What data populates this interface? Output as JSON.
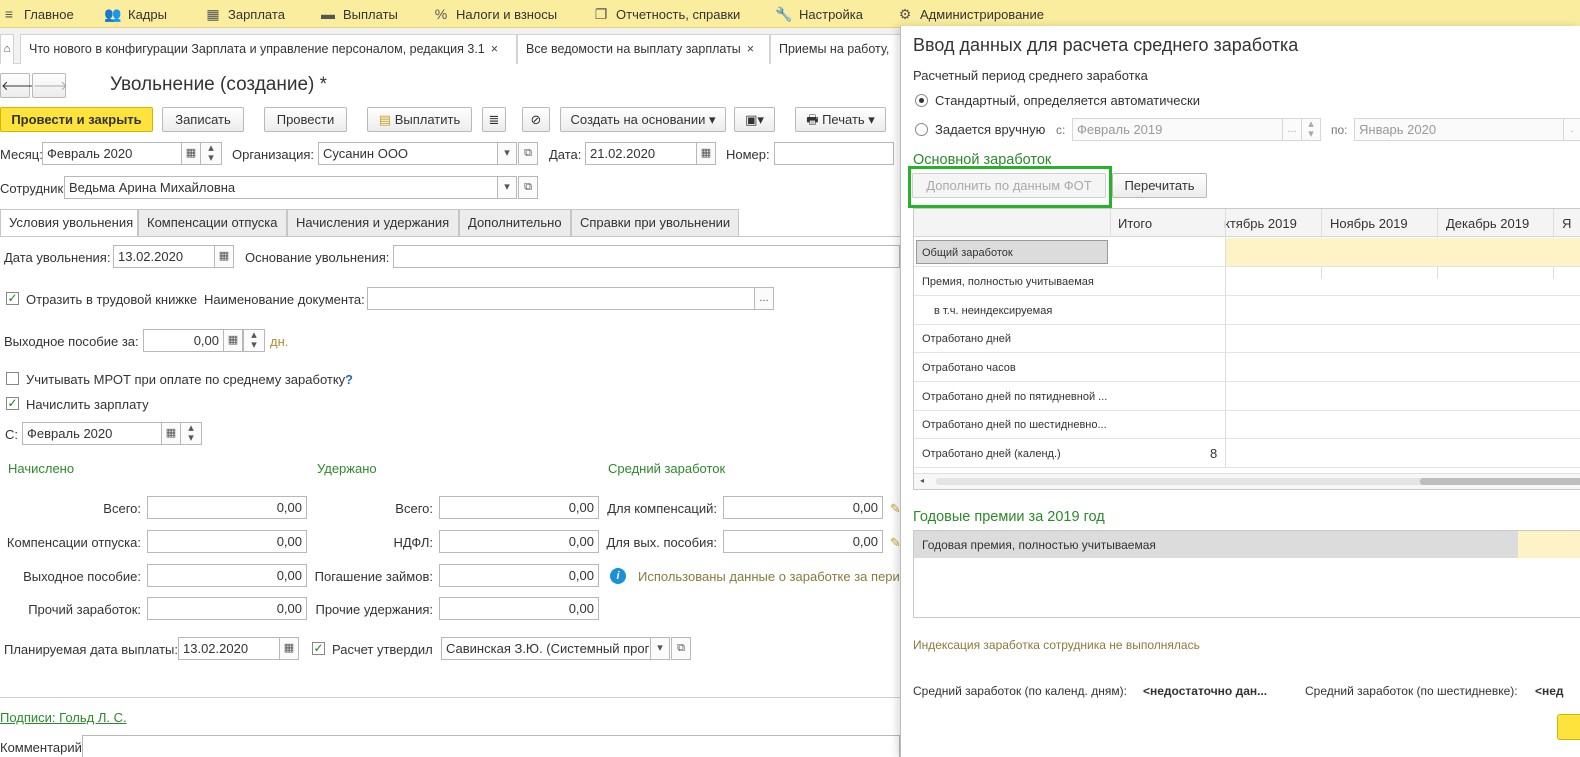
{
  "menu": {
    "items": [
      {
        "icon": "≡",
        "label": "Главное"
      },
      {
        "icon": "👥",
        "label": "Кадры"
      },
      {
        "icon": "▦",
        "label": "Зарплата"
      },
      {
        "icon": "▬",
        "label": "Выплаты"
      },
      {
        "icon": "%",
        "label": "Налоги и взносы"
      },
      {
        "icon": "❐",
        "label": "Отчетность, справки"
      },
      {
        "icon": "🔧",
        "label": "Настройка"
      },
      {
        "icon": "⚙",
        "label": "Администрирование"
      }
    ]
  },
  "open_tabs": [
    {
      "label": "Что нового в конфигурации Зарплата и управление персоналом, редакция 3.1",
      "close": "×"
    },
    {
      "label": "Все ведомости на выплату зарплаты",
      "close": "×"
    },
    {
      "label": "Приемы на работу,",
      "close": ""
    }
  ],
  "doc": {
    "title": "Увольнение (создание) *",
    "toolbar": {
      "post_close": "Провести и закрыть",
      "save": "Записать",
      "post": "Провести",
      "pay": "Выплатить",
      "create_based": "Создать на основании",
      "print": "Печать"
    },
    "month_label": "Месяц:",
    "month_value": "Февраль 2020",
    "org_label": "Организация:",
    "org_value": "Сусанин ООО",
    "date_label": "Дата:",
    "date_value": "21.02.2020",
    "number_label": "Номер:",
    "number_value": "",
    "employee_label": "Сотрудник:",
    "employee_value": "Ведьма Арина Михайловна",
    "tabs": [
      "Условия увольнения",
      "Компенсации отпуска",
      "Начисления и удержания",
      "Дополнительно",
      "Справки при увольнении"
    ],
    "dismissal_date_label": "Дата увольнения:",
    "dismissal_date_value": "13.02.2020",
    "basis_label": "Основание увольнения:",
    "basis_value": "",
    "workbook_label": "Отразить в трудовой книжке",
    "doc_name_label": "Наименование документа:",
    "doc_name_value": "",
    "severance_label": "Выходное пособие за:",
    "severance_value": "0,00",
    "severance_unit": "дн.",
    "mrot_label": "Учитывать МРОТ при оплате по среднему заработку",
    "help": "?",
    "accrue_label": "Начислить зарплату",
    "from_label": "С:",
    "from_value": "Февраль 2020",
    "accrued_title": "Начислено",
    "withheld_title": "Удержано",
    "avg_title": "Средний заработок",
    "accrued": [
      {
        "label": "Всего:",
        "value": "0,00"
      },
      {
        "label": "Компенсации отпуска:",
        "value": "0,00"
      },
      {
        "label": "Выходное пособие:",
        "value": "0,00"
      },
      {
        "label": "Прочий заработок:",
        "value": "0,00"
      }
    ],
    "withheld": [
      {
        "label": "Всего:",
        "value": "0,00"
      },
      {
        "label": "НДФЛ:",
        "value": "0,00"
      },
      {
        "label": "Погашение займов:",
        "value": "0,00"
      },
      {
        "label": "Прочие удержания:",
        "value": "0,00"
      }
    ],
    "avg": [
      {
        "label": "Для компенсаций:",
        "value": "0,00"
      },
      {
        "label": "Для вых. пособия:",
        "value": "0,00"
      }
    ],
    "avg_info": "Использованы данные о заработке за перио",
    "planned_date_label": "Планируемая дата выплаты:",
    "planned_date_value": "13.02.2020",
    "approved_label": "Расчет утвердил",
    "approved_value": "Савинская З.Ю. (Системный прог",
    "signatures": "Подписи: Гольд Л. С.",
    "comment_label": "Комментарий:"
  },
  "dialog": {
    "title": "Ввод данных для расчета среднего заработка",
    "period_label": "Расчетный период среднего заработка",
    "radio_standard": "Стандартный, определяется автоматически",
    "radio_manual": "Задается вручную",
    "from_label": "с:",
    "from_value": "Февраль 2019",
    "to_label": "по:",
    "to_value": "Январь 2020",
    "dots": "...",
    "main_earnings_title": "Основной заработок",
    "fill_fot": "Дополнить по данным ФОТ",
    "recalc": "Перечитать",
    "columns": [
      "Итого",
      "ктябрь 2019",
      "Ноябрь 2019",
      "Декабрь 2019",
      "Я"
    ],
    "rows": [
      {
        "label": "Общий заработок",
        "total": ""
      },
      {
        "label": "Премия, полностью учитываемая",
        "total": ""
      },
      {
        "label": "в т.ч. неиндексируемая",
        "total": ""
      },
      {
        "label": "Отработано дней",
        "total": ""
      },
      {
        "label": "Отработано часов",
        "total": ""
      },
      {
        "label": "Отработано дней по пятидневной ...",
        "total": ""
      },
      {
        "label": "Отработано дней по шестидневно...",
        "total": ""
      },
      {
        "label": "Отработано дней (календ.)",
        "total": "8"
      }
    ],
    "annual_title": "Годовые премии за 2019 год",
    "annual_row": "Годовая премия, полностью учитываемая",
    "indexation": "Индексация заработка сотрудника не выполнялась",
    "avg_calendar_label": "Средний заработок (по календ. дням):",
    "avg_calendar_value": "<недостаточно дан...",
    "avg_six_label": "Средний заработок (по шестидневке):",
    "avg_six_value": "<нед"
  },
  "colors": {
    "menu_bg": "#fbed9e",
    "accent_yellow": "#fde33c",
    "green_text": "#2b8a2b",
    "highlight_box": "#27b327",
    "row_highlight": "#fdf3c6"
  }
}
